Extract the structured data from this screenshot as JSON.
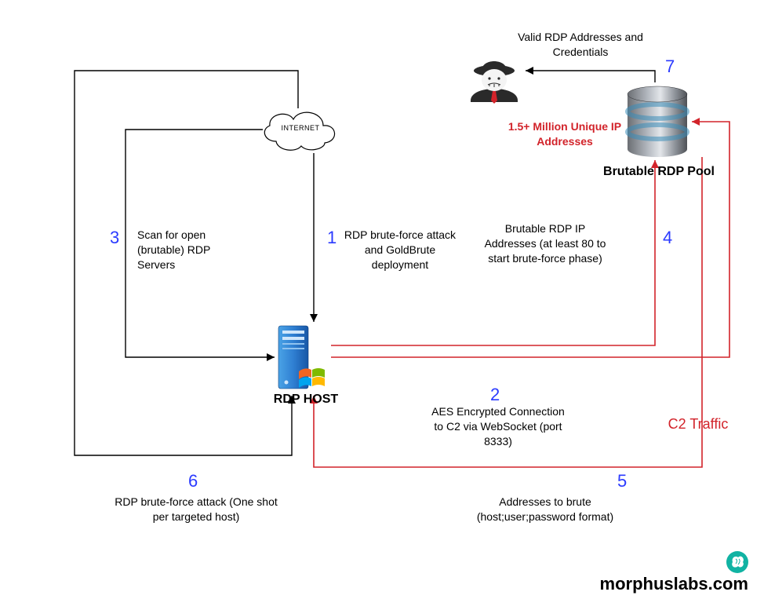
{
  "nodes": {
    "internet": {
      "label": "INTERNET"
    },
    "rdpHost": {
      "label": "RDP HOST"
    },
    "pool": {
      "label": "Brutable RDP Pool",
      "note": "1.5+ Million Unique IP Addresses"
    },
    "attacker_top_text": "Valid RDP Addresses and Credentials"
  },
  "steps": {
    "s1": {
      "num": "1",
      "text": "RDP brute-force attack and GoldBrute deployment"
    },
    "s2": {
      "num": "2",
      "text": "AES Encrypted Connection to C2 via WebSocket (port 8333)"
    },
    "s3": {
      "num": "3",
      "text": "Scan for open (brutable) RDP Servers"
    },
    "s4": {
      "num": "4",
      "text": "Brutable RDP IP Addresses (at least 80 to start brute-force phase)"
    },
    "s5": {
      "num": "5",
      "text": "Addresses to brute (host;user;password format)"
    },
    "s6": {
      "num": "6",
      "text": "RDP brute-force attack (One shot per targeted host)"
    },
    "s7": {
      "num": "7"
    }
  },
  "labels": {
    "c2traffic": "C2 Traffic"
  },
  "branding": "morphuslabs.com"
}
